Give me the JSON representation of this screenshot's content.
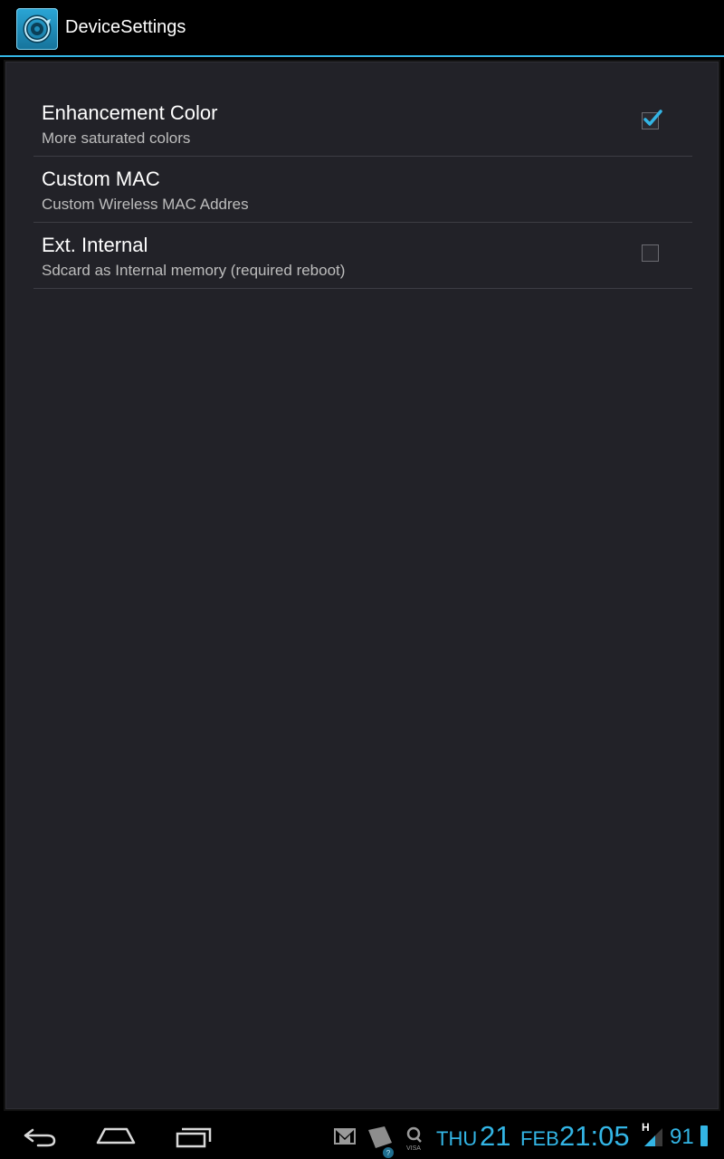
{
  "app": {
    "title": "DeviceSettings",
    "icon": "gear-sync-icon"
  },
  "preferences": [
    {
      "title": "Enhancement Color",
      "summary": "More saturated colors",
      "has_checkbox": true,
      "checked": true
    },
    {
      "title": "Custom MAC",
      "summary": "Custom Wireless MAC Addres",
      "has_checkbox": false,
      "checked": false
    },
    {
      "title": "Ext. Internal",
      "summary": "Sdcard as Internal memory (required reboot)",
      "has_checkbox": true,
      "checked": false
    }
  ],
  "system_bar": {
    "nav": [
      "back-icon",
      "home-icon",
      "recent-apps-icon"
    ],
    "notification_icons": [
      "gmail-icon",
      "market-update-icon",
      "visa-icon"
    ],
    "day": "THU",
    "date": "21",
    "month": "FEB",
    "time": "21:05",
    "network": "H",
    "battery": "91"
  },
  "colors": {
    "accent": "#33b5e5",
    "background": "#222228",
    "text_primary": "#ffffff",
    "text_secondary": "#bdbdbd"
  }
}
